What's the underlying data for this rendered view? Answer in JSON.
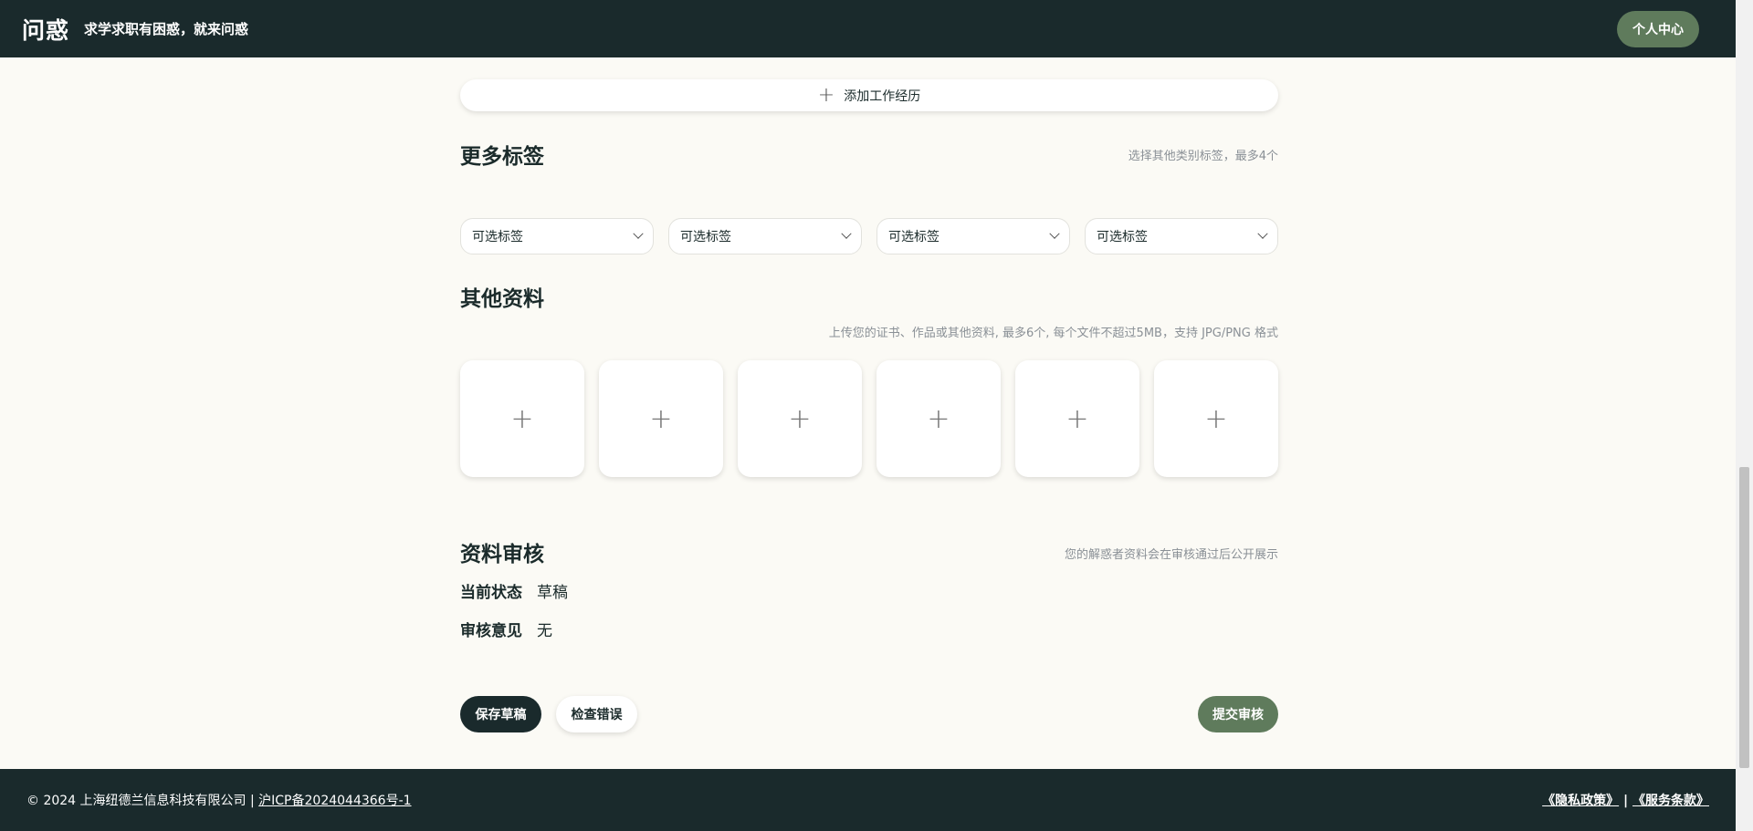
{
  "header": {
    "logo": "问惑",
    "tagline": "求学求职有困惑，就来问惑",
    "profile_button": "个人中心"
  },
  "work_experience": {
    "add_button": "添加工作经历"
  },
  "more_tags": {
    "title": "更多标签",
    "hint": "选择其他类别标签，最多4个",
    "selects": [
      {
        "value": "可选标签"
      },
      {
        "value": "可选标签"
      },
      {
        "value": "可选标签"
      },
      {
        "value": "可选标签"
      }
    ]
  },
  "other_materials": {
    "title": "其他资料",
    "hint": "上传您的证书、作品或其他资料, 最多6个, 每个文件不超过5MB，支持 JPG/PNG 格式",
    "upload_slot_count": 6
  },
  "review": {
    "title": "资料审核",
    "hint": "您的解惑者资料会在审核通过后公开展示",
    "status_label": "当前状态",
    "status_value": "草稿",
    "comment_label": "审核意见",
    "comment_value": "无"
  },
  "actions": {
    "save_draft": "保存草稿",
    "check_errors": "检查错误",
    "submit_review": "提交审核"
  },
  "footer": {
    "copyright": "© 2024 上海纽德兰信息科技有限公司 |",
    "icp": "沪ICP备2024044366号-1",
    "privacy": "《隐私政策》",
    "separator": "|",
    "terms": "《服务条款》"
  }
}
